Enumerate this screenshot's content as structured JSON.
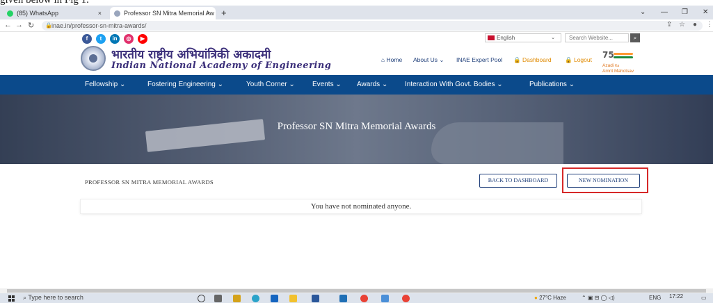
{
  "document": {
    "caption": "given below in Fig 1."
  },
  "browser": {
    "tabs": [
      {
        "label": "(85) WhatsApp",
        "active": false
      },
      {
        "label": "Professor SN Mitra Memorial Aw",
        "active": true
      }
    ],
    "new_tab_glyph": "+",
    "close_glyph": "×",
    "url": "inae.in/professor-sn-mitra-awards/"
  },
  "site": {
    "language": "English",
    "search_placeholder": "Search Website...",
    "logo_hindi": "भारतीय राष्ट्रीय अभियांत्रिकी अकादमी",
    "logo_english": "Indian National Academy of Engineering",
    "top_links": {
      "home": "Home",
      "about": "About Us",
      "expert_pool": "INAE Expert Pool",
      "dashboard": "Dashboard",
      "logout": "Logout"
    },
    "azadi": {
      "line1": "Azadi",
      "line2": "Ka",
      "line3": "Amrit Mahotsav",
      "number": "75"
    },
    "nav": [
      "Fellowship",
      "Fostering Engineering",
      "Youth Corner",
      "Events",
      "Awards",
      "Interaction With Govt. Bodies",
      "Publications"
    ],
    "banner_title": "Professor SN Mitra Memorial Awards",
    "section_title": "PROFESSOR SN MITRA MEMORIAL AWARDS",
    "back_button": "BACK TO DASHBOARD",
    "new_button": "NEW NOMINATION",
    "empty_message": "You have not nominated anyone."
  },
  "taskbar": {
    "search_placeholder": "Type here to search",
    "weather": "27°C Haze",
    "language": "ENG",
    "time": "17:22"
  },
  "colors": {
    "nav_blue": "#0b4a8b",
    "highlight_red": "#d62828",
    "link_blue": "#1f3f7a",
    "accent_orange": "#e08a00"
  }
}
